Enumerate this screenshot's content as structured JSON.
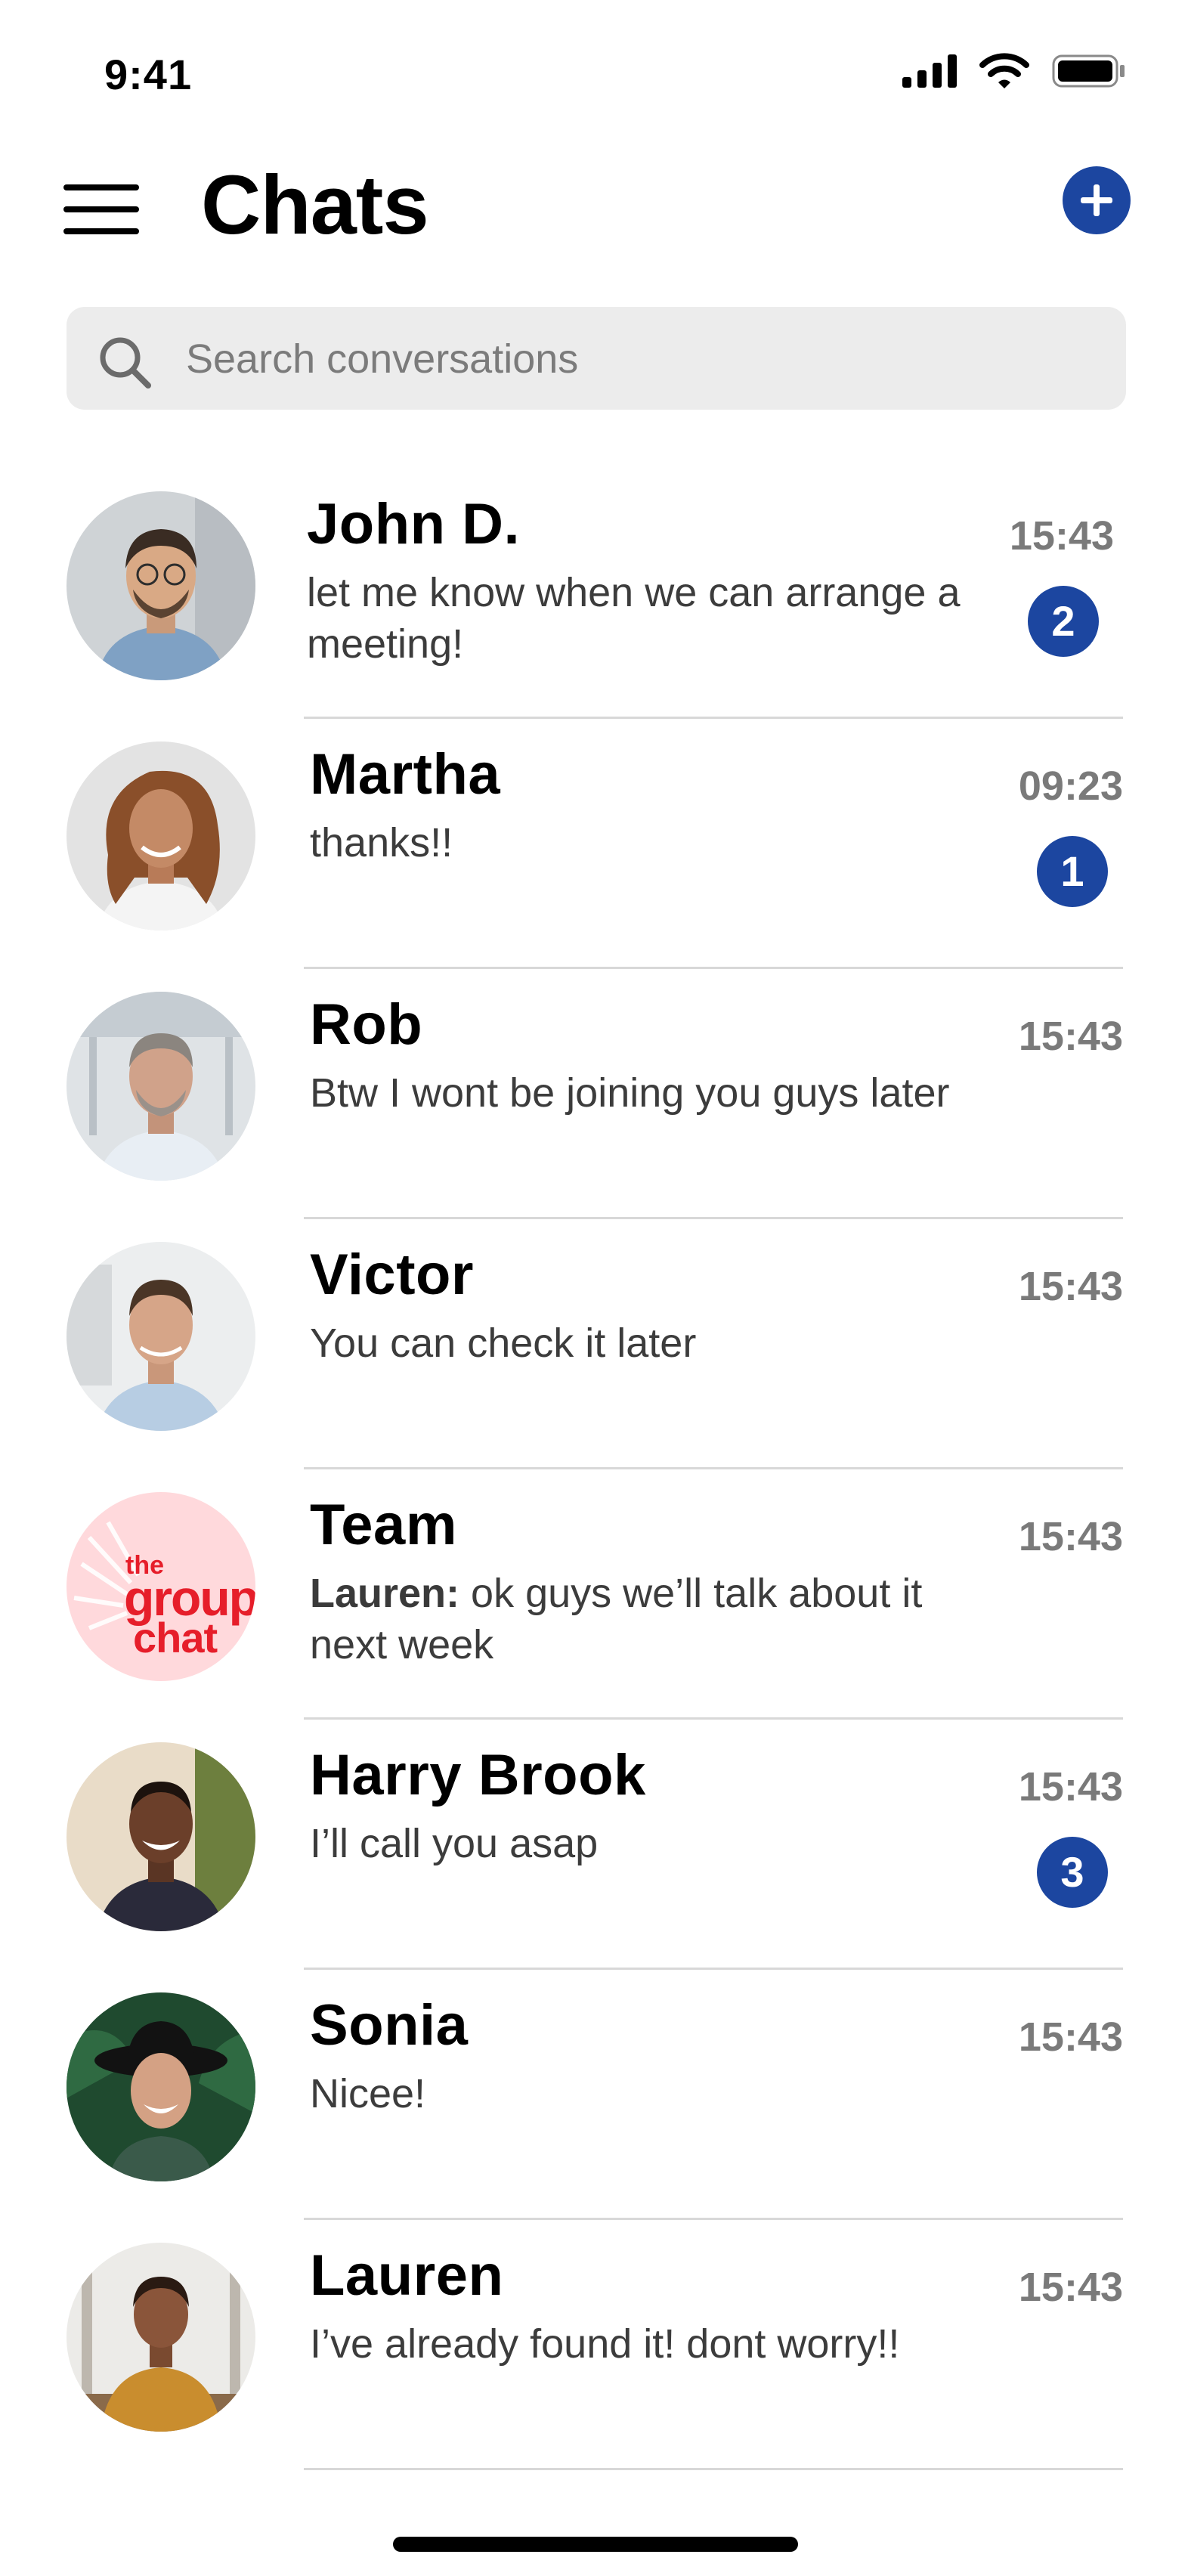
{
  "status_bar": {
    "time": "9:41"
  },
  "header": {
    "title": "Chats"
  },
  "search": {
    "placeholder": "Search conversations"
  },
  "colors": {
    "accent": "#1c46a0",
    "divider": "#d8d8d8",
    "search_bg": "#ececec"
  },
  "chats": [
    {
      "name": "John D.",
      "message": "let me  know when we can arrange a meeting!",
      "time": "15:43",
      "unread": "2"
    },
    {
      "name": "Martha",
      "message": "thanks!!",
      "time": "09:23",
      "unread": "1"
    },
    {
      "name": "Rob",
      "message": "Btw I wont be joining you guys later",
      "time": "15:43"
    },
    {
      "name": "Victor",
      "message": "You can check it later",
      "time": "15:43"
    },
    {
      "name": "Team",
      "sender": "Lauren:",
      "message": "ok guys we’ll talk about it next week",
      "time": "15:43",
      "avatar_text": [
        "the",
        "group",
        "chat"
      ]
    },
    {
      "name": "Harry Brook",
      "message": "I’ll call you asap",
      "time": "15:43",
      "unread": "3"
    },
    {
      "name": "Sonia",
      "message": "Nicee!",
      "time": "15:43"
    },
    {
      "name": "Lauren",
      "message": "I’ve already found it! dont worry!!",
      "time": "15:43"
    }
  ]
}
